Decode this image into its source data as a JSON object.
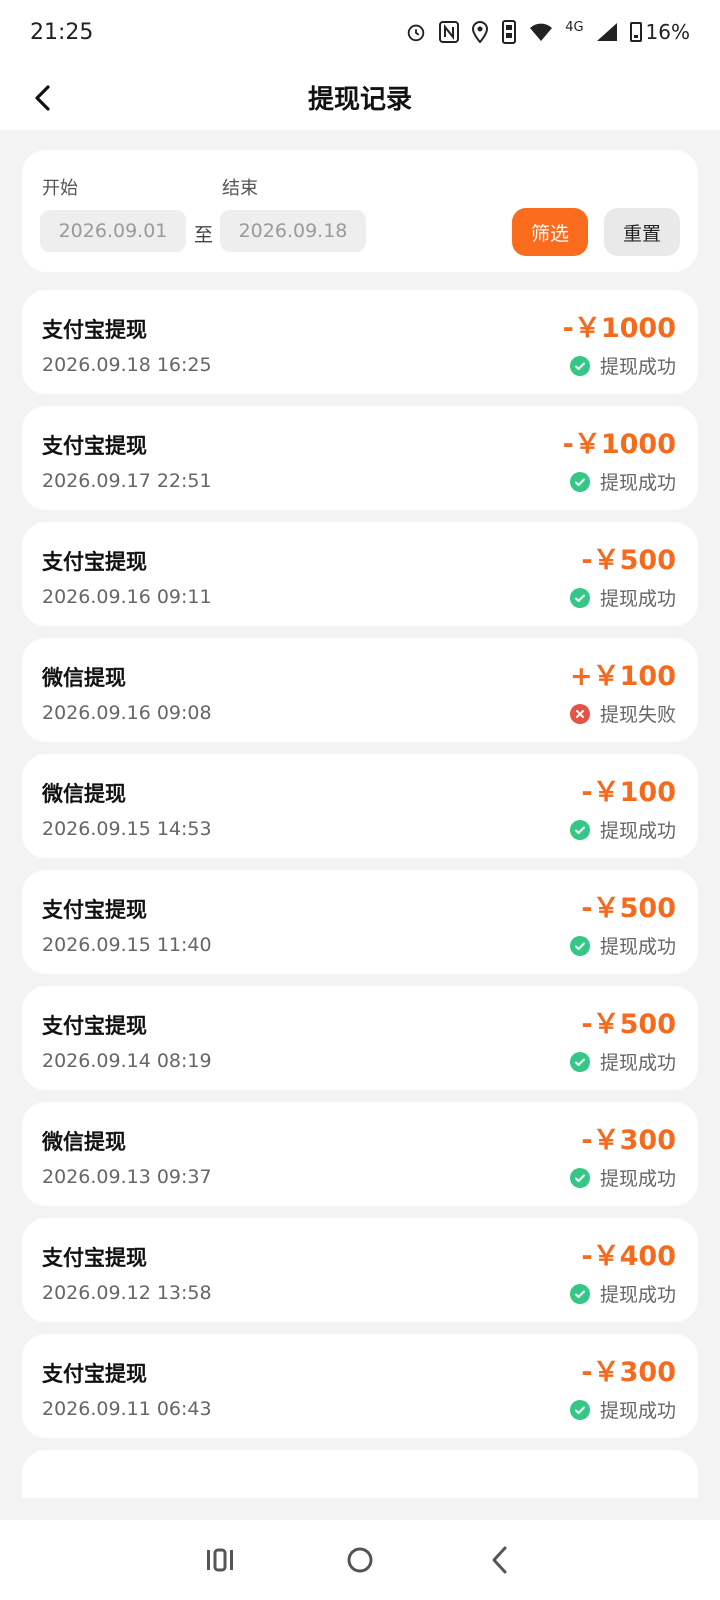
{
  "status_bar": {
    "time": "21:25",
    "network": "4G",
    "battery": "16%",
    "icons": [
      "alarm-icon",
      "nfc-icon",
      "location-icon",
      "vibrate-icon",
      "wifi-icon",
      "signal-icon",
      "battery-icon"
    ]
  },
  "header": {
    "title": "提现记录",
    "back_icon": "back-arrow-icon"
  },
  "filter": {
    "start_label": "开始",
    "end_label": "结束",
    "start_value": "2026.09.01",
    "end_value": "2026.09.18",
    "to_label": "至",
    "filter_button": "筛选",
    "reset_button": "重置",
    "accent_color": "#fb6b1e"
  },
  "records": [
    {
      "name": "支付宝提现",
      "time": "2026.09.18  16:25",
      "amount": "-￥1000",
      "status": "提现成功",
      "state": "success"
    },
    {
      "name": "支付宝提现",
      "time": "2026.09.17  22:51",
      "amount": "-￥1000",
      "status": "提现成功",
      "state": "success"
    },
    {
      "name": "支付宝提现",
      "time": "2026.09.16  09:11",
      "amount": "-￥500",
      "status": "提现成功",
      "state": "success"
    },
    {
      "name": "微信提现",
      "time": "2026.09.16  09:08",
      "amount": "+￥100",
      "status": "提现失败",
      "state": "fail"
    },
    {
      "name": "微信提现",
      "time": "2026.09.15  14:53",
      "amount": "-￥100",
      "status": "提现成功",
      "state": "success"
    },
    {
      "name": "支付宝提现",
      "time": "2026.09.15  11:40",
      "amount": "-￥500",
      "status": "提现成功",
      "state": "success"
    },
    {
      "name": "支付宝提现",
      "time": "2026.09.14  08:19",
      "amount": "-￥500",
      "status": "提现成功",
      "state": "success"
    },
    {
      "name": "微信提现",
      "time": "2026.09.13  09:37",
      "amount": "-￥300",
      "status": "提现成功",
      "state": "success"
    },
    {
      "name": "支付宝提现",
      "time": "2026.09.12  13:58",
      "amount": "-￥400",
      "status": "提现成功",
      "state": "success"
    },
    {
      "name": "支付宝提现",
      "time": "2026.09.11  06:43",
      "amount": "-￥300",
      "status": "提现成功",
      "state": "success"
    }
  ],
  "colors": {
    "amount": "#f56b1e",
    "success": "#34c786",
    "fail": "#e65346"
  },
  "bottom_nav": {
    "icons": [
      "recent-apps-icon",
      "home-icon",
      "back-icon"
    ]
  }
}
